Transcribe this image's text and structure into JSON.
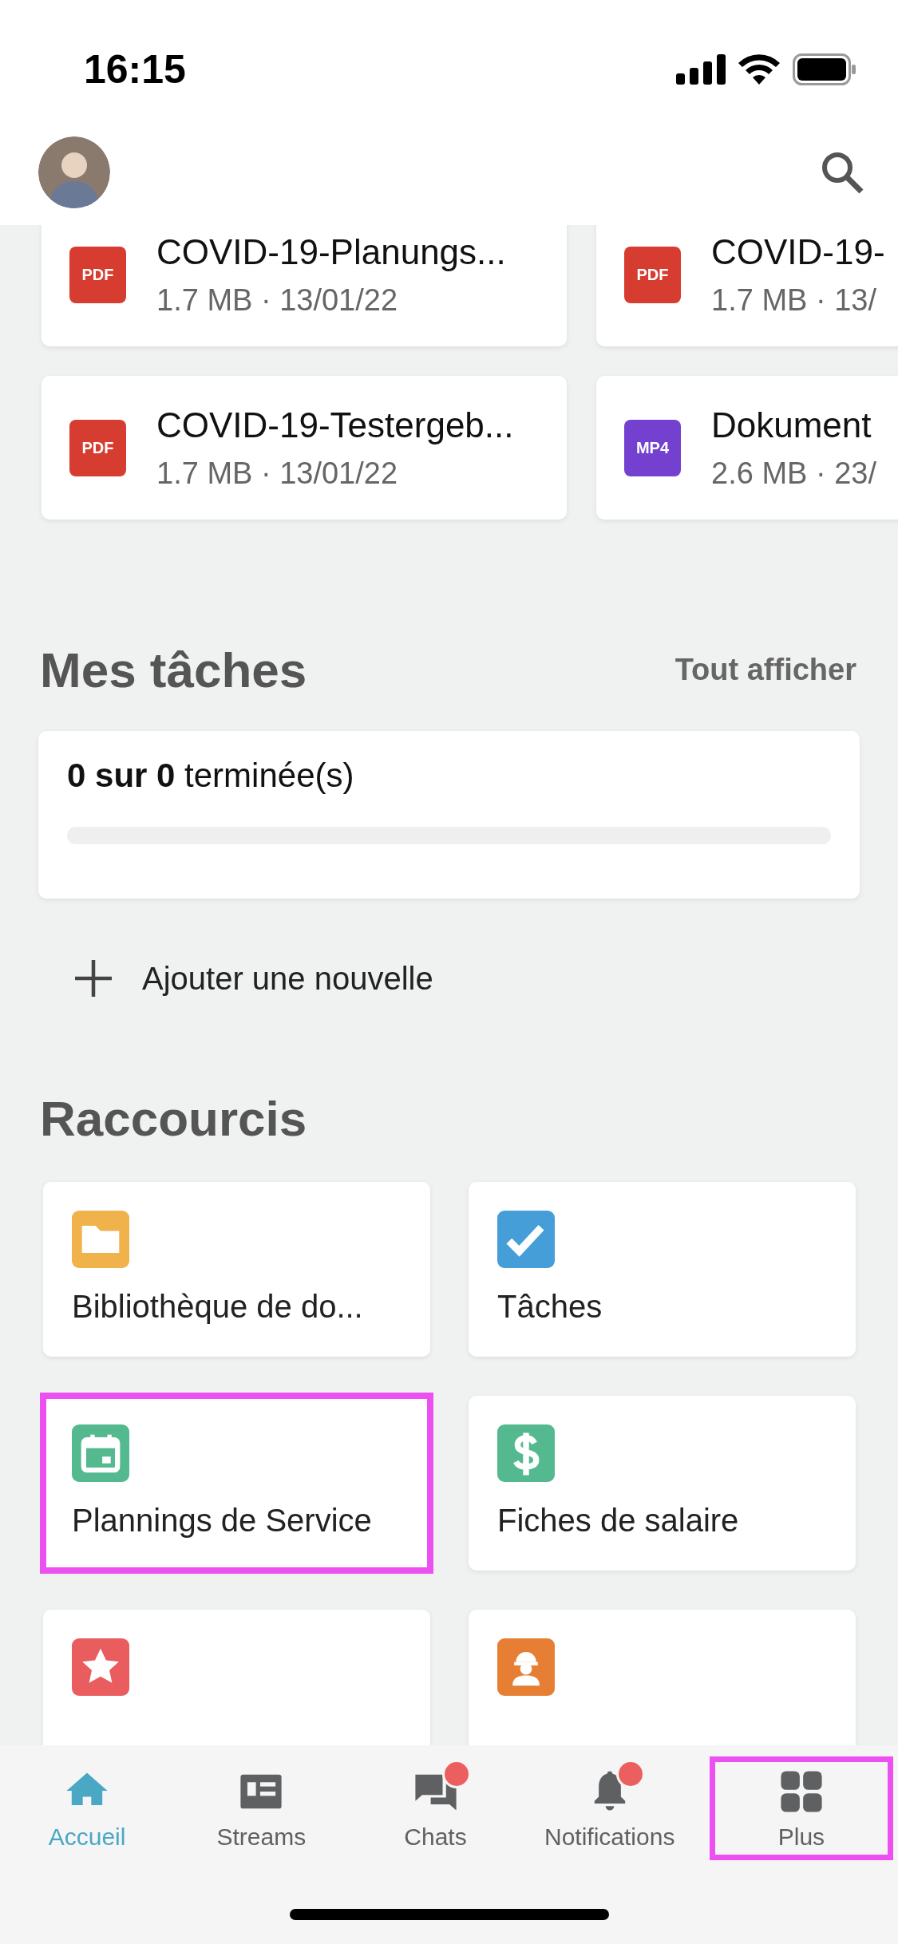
{
  "status_bar": {
    "time": "16:15"
  },
  "files": [
    {
      "name": "COVID-19-Planungs...",
      "meta": "1.7 MB · 13/01/22",
      "badge": "PDF",
      "color": "#d63c2f"
    },
    {
      "name": "COVID-19-",
      "meta": "1.7 MB · 13/",
      "badge": "PDF",
      "color": "#d63c2f"
    },
    {
      "name": "COVID-19-Testergeb...",
      "meta": "1.7 MB · 13/01/22",
      "badge": "PDF",
      "color": "#d63c2f"
    },
    {
      "name": "Dokument",
      "meta": "2.6 MB · 23/",
      "badge": "MP4",
      "color": "#7440d0"
    }
  ],
  "tasks": {
    "title": "Mes tâches",
    "link": "Tout afficher",
    "count_bold": "0 sur 0",
    "count_rest": "terminée(s)",
    "level": 0,
    "add_label": "Ajouter une nouvelle"
  },
  "shortcuts_title": "Raccourcis",
  "shortcuts": [
    {
      "kind": "folder",
      "color": "#f0b24a",
      "label": "Bibliothèque de do...",
      "highlighted": false
    },
    {
      "kind": "check",
      "color": "#459ed8",
      "label": "Tâches",
      "highlighted": false
    },
    {
      "kind": "calendar",
      "color": "#55b98f",
      "label": "Plannings de Service",
      "highlighted": true
    },
    {
      "kind": "dollar",
      "color": "#55b98f",
      "label": "Fiches de salaire",
      "highlighted": false
    },
    {
      "kind": "star",
      "color": "#ea5d5e",
      "highlighted": false
    },
    {
      "kind": "worker",
      "color": "#e67f33",
      "highlighted": false
    }
  ],
  "nav": [
    {
      "kind": "home",
      "label": "Accueil",
      "selected": true,
      "badge": false,
      "highlighted": false
    },
    {
      "kind": "streams",
      "label": "Streams",
      "selected": false,
      "badge": false,
      "highlighted": false
    },
    {
      "kind": "chats",
      "label": "Chats",
      "selected": false,
      "badge": true,
      "highlighted": false
    },
    {
      "kind": "bell",
      "label": "Notifications",
      "selected": false,
      "badge": true,
      "highlighted": false
    },
    {
      "kind": "grid",
      "label": "Plus",
      "selected": false,
      "badge": false,
      "highlighted": true
    }
  ]
}
